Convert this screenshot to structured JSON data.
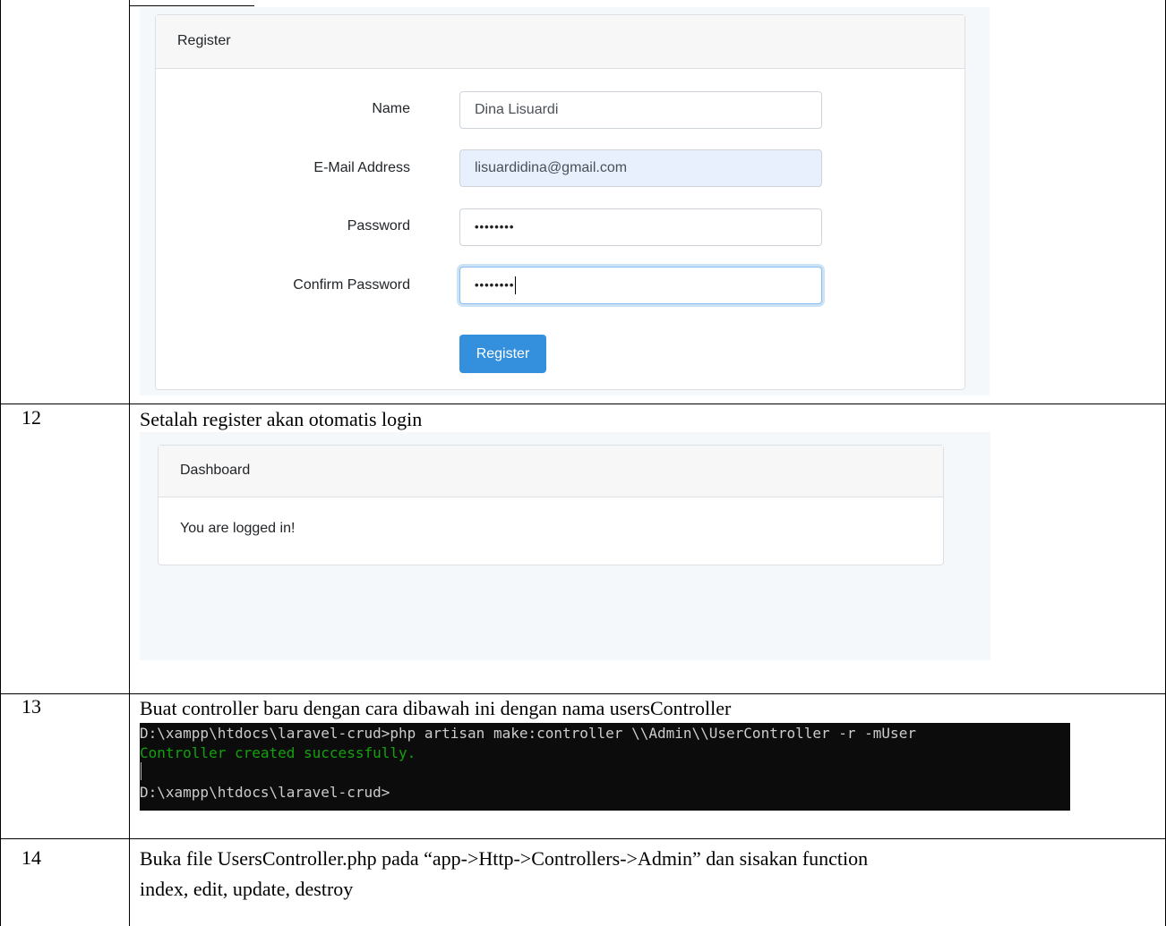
{
  "register_form": {
    "header": "Register",
    "fields": [
      {
        "label": "Name",
        "value": "Dina Lisuardi"
      },
      {
        "label": "E-Mail Address",
        "value": "lisuardidina@gmail.com"
      },
      {
        "label": "Password",
        "value": "••••••••"
      },
      {
        "label": "Confirm Password",
        "value": "••••••••"
      }
    ],
    "button": "Register"
  },
  "rows": [
    {
      "number": "12",
      "text": "Setalah register akan otomatis login"
    },
    {
      "number": "13",
      "text": "Buat controller baru dengan cara dibawah ini dengan nama usersController"
    },
    {
      "number": "14",
      "text_line1": "Buka file UsersController.php pada “app->Http->Controllers->Admin” dan sisakan function",
      "text_line2": "index, edit, update, destroy"
    }
  ],
  "dashboard": {
    "header": "Dashboard",
    "message": "You are logged in!"
  },
  "terminal": {
    "line1": "D:\\xampp\\htdocs\\laravel-crud>php artisan make:controller \\\\Admin\\\\UserController -r -mUser",
    "line2": "Controller created successfully.",
    "line3": "D:\\xampp\\htdocs\\laravel-crud>"
  }
}
